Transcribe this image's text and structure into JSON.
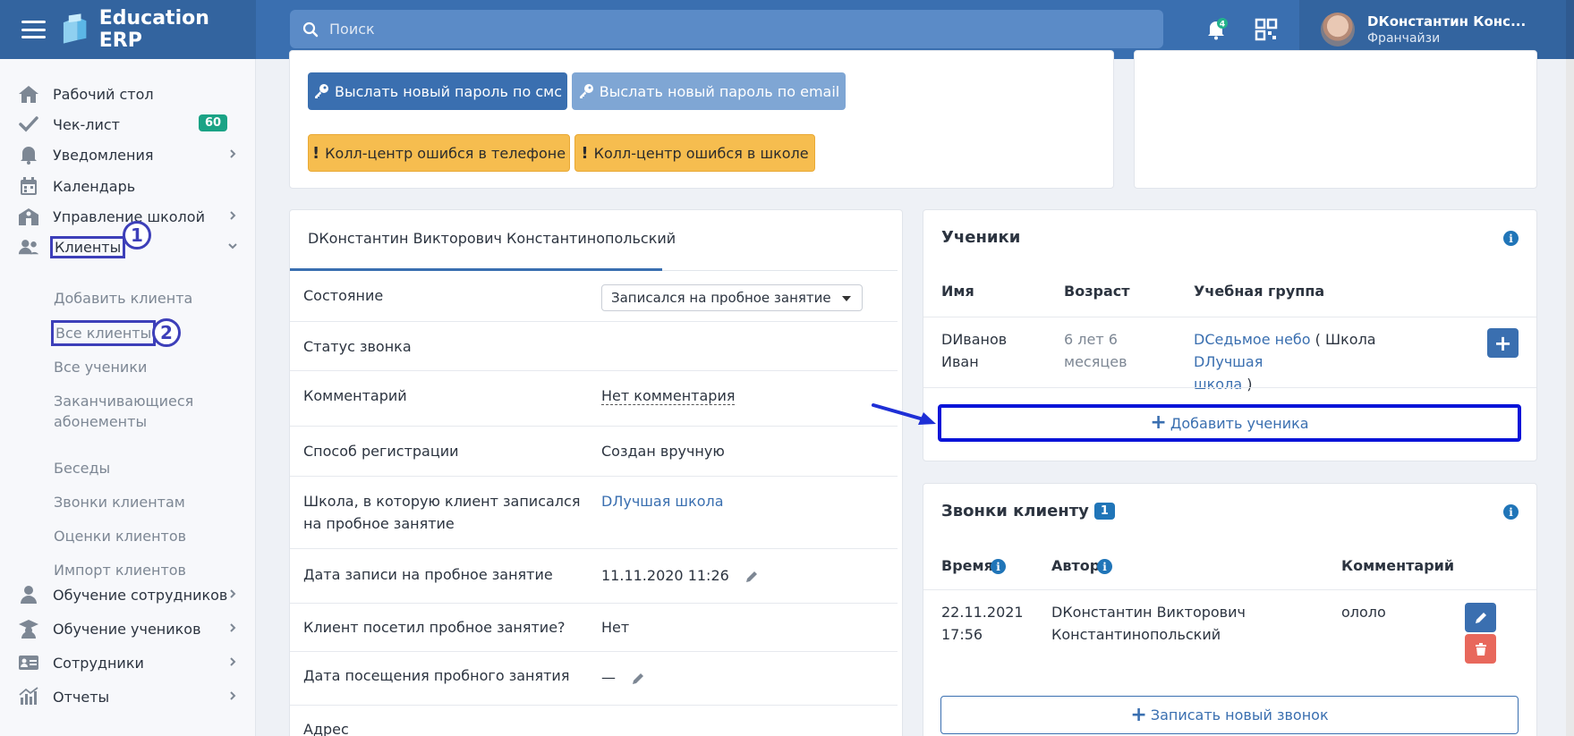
{
  "header": {
    "brand": "Education ERP",
    "search_placeholder": "Поиск",
    "notifications_count": "4",
    "user_name": "DКонстантин Конс...",
    "user_role": "Франчайзи"
  },
  "sidebar": {
    "items": [
      {
        "label": "Рабочий стол",
        "icon": "home-icon"
      },
      {
        "label": "Чек-лист",
        "icon": "check-icon",
        "badge": "60"
      },
      {
        "label": "Уведомления",
        "icon": "bell-icon"
      },
      {
        "label": "Календарь",
        "icon": "calendar-icon"
      },
      {
        "label": "Управление школой",
        "icon": "school-icon"
      },
      {
        "label": "Клиенты",
        "icon": "users-icon"
      },
      {
        "label": "Обучение сотрудников",
        "icon": "user-icon"
      },
      {
        "label": "Обучение учеников",
        "icon": "graduate-icon"
      },
      {
        "label": "Сотрудники",
        "icon": "id-card-icon"
      },
      {
        "label": "Отчеты",
        "icon": "chart-icon"
      }
    ],
    "clients_sub": [
      "Добавить клиента",
      "Все клиенты",
      "Все ученики",
      "Заканчивающиеся абонементы",
      "Беседы",
      "Звонки клиентам",
      "Оценки клиентов",
      "Импорт клиентов"
    ],
    "sub_line2": "абонементы",
    "marker1": "1",
    "marker2": "2"
  },
  "actions": {
    "sms_password": "Выслать новый пароль по смс",
    "email_password": "Выслать новый пароль по email",
    "callcenter_phone": "Колл-центр ошибся в телефоне",
    "callcenter_school": "Колл-центр ошибся в школе"
  },
  "client": {
    "tab": "DКонстантин Викторович Константинопольский",
    "rows": [
      {
        "label": "Состояние",
        "value": "Записался на пробное занятие"
      },
      {
        "label": "Статус звонка",
        "value": ""
      },
      {
        "label": "Комментарий",
        "value": "Нет комментария"
      },
      {
        "label": "Способ регистрации",
        "value": "Создан вручную"
      },
      {
        "label": "Школа, в которую клиент записался",
        "label2": "на пробное занятие",
        "value": "DЛучшая школа"
      },
      {
        "label": "Дата записи на пробное занятие",
        "value": "11.11.2020 11:26"
      },
      {
        "label": "Клиент посетил пробное занятие?",
        "value": "Нет"
      },
      {
        "label": "Дата посещения пробного занятия",
        "value": "—"
      },
      {
        "label": "Адрес",
        "value": ""
      }
    ]
  },
  "students": {
    "title": "Ученики",
    "columns": [
      "Имя",
      "Возраст",
      "Учебная группа"
    ],
    "row": {
      "name1": "DИванов",
      "name2": "Иван",
      "age1": "6 лет 6",
      "age2": "месяцев",
      "group": "DСедьмое небо",
      "school_prefix": "( Школа",
      "school": "DЛучшая",
      "school2": "школа",
      "close": ")"
    },
    "add_button": "Добавить ученика"
  },
  "calls": {
    "title": "Звонки клиенту",
    "count": "1",
    "columns": [
      "Время",
      "Автор",
      "Комментарий"
    ],
    "row": {
      "date": "22.11.2021",
      "time": "17:56",
      "author1": "DКонстантин Викторович",
      "author2": "Константинопольский",
      "comment": "ололо"
    },
    "add_button": "Записать новый звонок"
  },
  "colors": {
    "primary": "#3a6fb0",
    "highlight": "#3d3fb9",
    "arrow": "#1e2fd6",
    "badge_green": "#1aa385",
    "warning": "#f6bd4f",
    "danger": "#e8685c"
  }
}
